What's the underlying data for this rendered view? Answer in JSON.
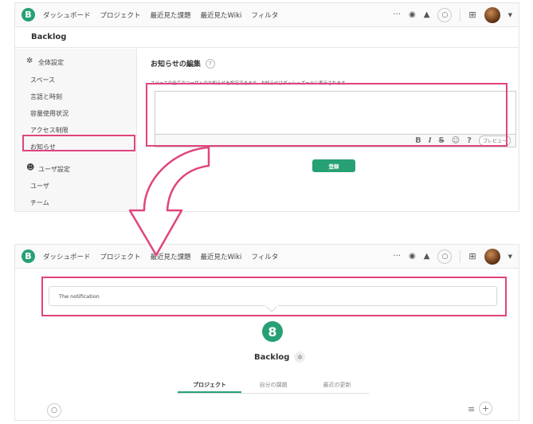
{
  "top": {
    "nav": {
      "logo": "B",
      "items": [
        "ダッシュボード",
        "プロジェクト",
        "最近見た課題",
        "最近見たWiki",
        "フィルタ"
      ],
      "more": "···"
    },
    "page_title": "Backlog",
    "sidebar": {
      "section1": "全体設定",
      "items1": [
        "スペース",
        "言語と時刻",
        "容量使用状況",
        "アクセス制限",
        "お知らせ"
      ],
      "section2": "ユーザ設定",
      "items2": [
        "ユーザ",
        "チーム"
      ]
    },
    "editor": {
      "heading": "お知らせの編集",
      "help": "?",
      "description": "スペースの全てのユーザへのお知らせを設定できます。お知らせはダッシュボードに表示されます。",
      "toolbar": [
        "B",
        "I",
        "S",
        "☺",
        "?"
      ],
      "preview_label": "プレビュー",
      "submit_label": "登録"
    }
  },
  "bottom": {
    "nav": {
      "logo": "B",
      "items": [
        "ダッシュボード",
        "プロジェクト",
        "最近見た課題",
        "最近見たWiki",
        "フィルタ"
      ],
      "more": "···"
    },
    "notification_text": "The notification",
    "space_name": "Backlog",
    "tabs": [
      "プロジェクト",
      "自分の課題",
      "最近の更新"
    ]
  },
  "colors": {
    "accent": "#27a074",
    "highlight": "#e0447f"
  }
}
